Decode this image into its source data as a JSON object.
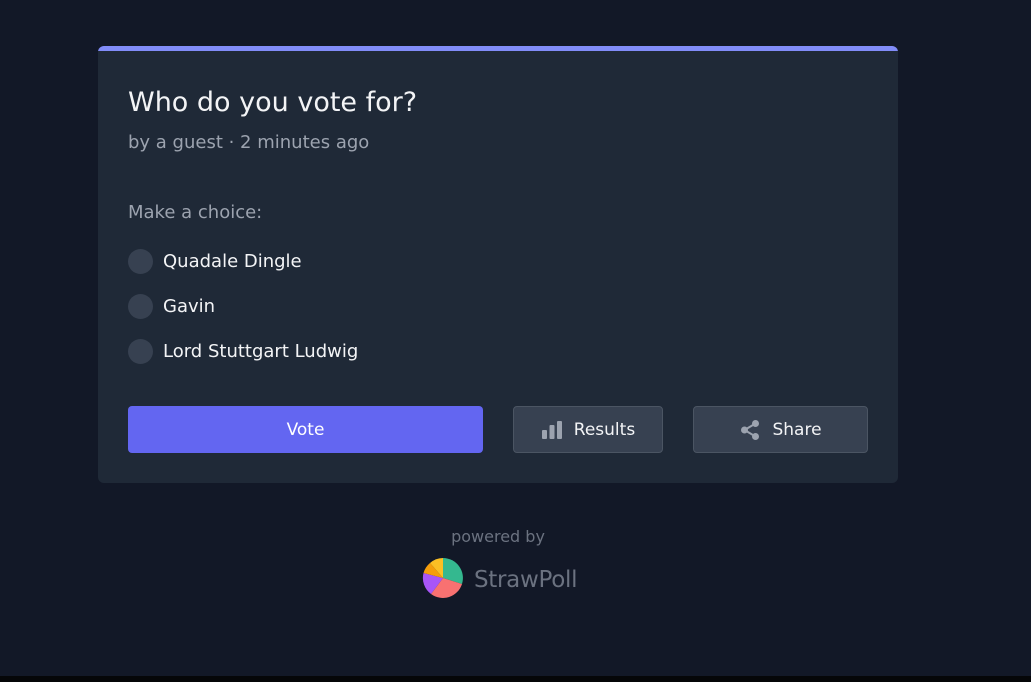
{
  "poll": {
    "title": "Who do you vote for?",
    "meta": "by a guest · 2 minutes ago",
    "prompt": "Make a choice:",
    "options": [
      {
        "label": "Quadale Dingle"
      },
      {
        "label": "Gavin"
      },
      {
        "label": "Lord Stuttgart Ludwig"
      }
    ]
  },
  "actions": {
    "vote_label": "Vote",
    "results_label": "Results",
    "results_icon": "bar-chart-icon",
    "share_label": "Share",
    "share_icon": "share-icon"
  },
  "footer": {
    "powered_by": "powered by",
    "brand_name": "StrawPoll",
    "brand_logo": "pie-chart-logo"
  },
  "colors": {
    "background": "#121827",
    "card": "#1f2937",
    "accent": "#818cf8",
    "vote_button": "#6366f1",
    "secondary_button": "#374151"
  }
}
